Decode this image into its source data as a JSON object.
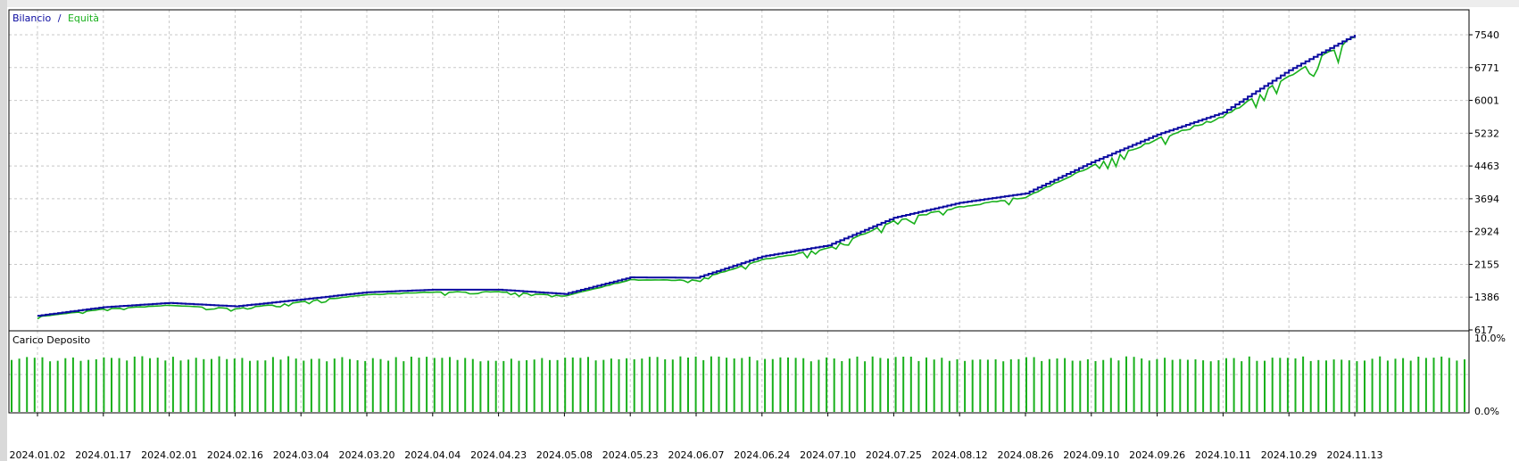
{
  "legend": {
    "balance_label": "Bilancio",
    "separator": "/",
    "equity_label": "Equità"
  },
  "subpanel_title": "Carico Deposito",
  "colors": {
    "balance": "#0a0aa0",
    "equity": "#19b01c",
    "grid": "#c8c8c8",
    "load_bar": "#19b01c",
    "frame": "#000000"
  },
  "chart_data": [
    {
      "type": "line",
      "title": "",
      "series": [
        {
          "name": "Bilancio",
          "x": [
            "2024.01.02",
            "2024.01.17",
            "2024.02.01",
            "2024.02.16",
            "2024.03.04",
            "2024.03.20",
            "2024.04.04",
            "2024.04.23",
            "2024.05.08",
            "2024.05.23",
            "2024.06.07",
            "2024.06.24",
            "2024.07.10",
            "2024.07.25",
            "2024.08.12",
            "2024.08.26",
            "2024.09.10",
            "2024.09.26",
            "2024.10.11",
            "2024.10.29",
            "2024.11.13"
          ],
          "values": [
            950,
            1150,
            1250,
            1170,
            1330,
            1500,
            1560,
            1560,
            1460,
            1850,
            1840,
            2340,
            2600,
            3250,
            3600,
            3820,
            4550,
            5200,
            5720,
            6710,
            7540
          ]
        },
        {
          "name": "Equità",
          "x": [
            "2024.01.02",
            "2024.01.17",
            "2024.02.01",
            "2024.02.16",
            "2024.03.04",
            "2024.03.20",
            "2024.04.04",
            "2024.04.23",
            "2024.05.08",
            "2024.05.23",
            "2024.06.07",
            "2024.06.24",
            "2024.07.10",
            "2024.07.25",
            "2024.08.12",
            "2024.08.26",
            "2024.09.10",
            "2024.09.26",
            "2024.10.11",
            "2024.10.29",
            "2024.11.13"
          ],
          "values": [
            930,
            1110,
            1200,
            1120,
            1280,
            1450,
            1510,
            1520,
            1420,
            1800,
            1790,
            2270,
            2540,
            3180,
            3520,
            3750,
            4470,
            5110,
            5640,
            6610,
            7520
          ]
        }
      ],
      "x_tick_labels": [
        "2024.01.02",
        "2024.01.17",
        "2024.02.01",
        "2024.02.16",
        "2024.03.04",
        "2024.03.20",
        "2024.04.04",
        "2024.04.23",
        "2024.05.08",
        "2024.05.23",
        "2024.06.07",
        "2024.06.24",
        "2024.07.10",
        "2024.07.25",
        "2024.08.12",
        "2024.08.26",
        "2024.09.10",
        "2024.09.26",
        "2024.10.11",
        "2024.10.29",
        "2024.11.13"
      ],
      "y_tick_labels": [
        "617",
        "1386",
        "2155",
        "2924",
        "3694",
        "4463",
        "5232",
        "6001",
        "6771",
        "7540"
      ],
      "ylim": [
        617,
        7540
      ],
      "grid": true,
      "legend_position": "top-left"
    },
    {
      "type": "bar",
      "title": "Carico Deposito",
      "y_tick_labels": [
        "0.0%",
        "10.0%"
      ],
      "ylim": [
        0,
        10
      ],
      "bar_count": 190,
      "values_pct": [
        6.8,
        7.5
      ]
    }
  ]
}
